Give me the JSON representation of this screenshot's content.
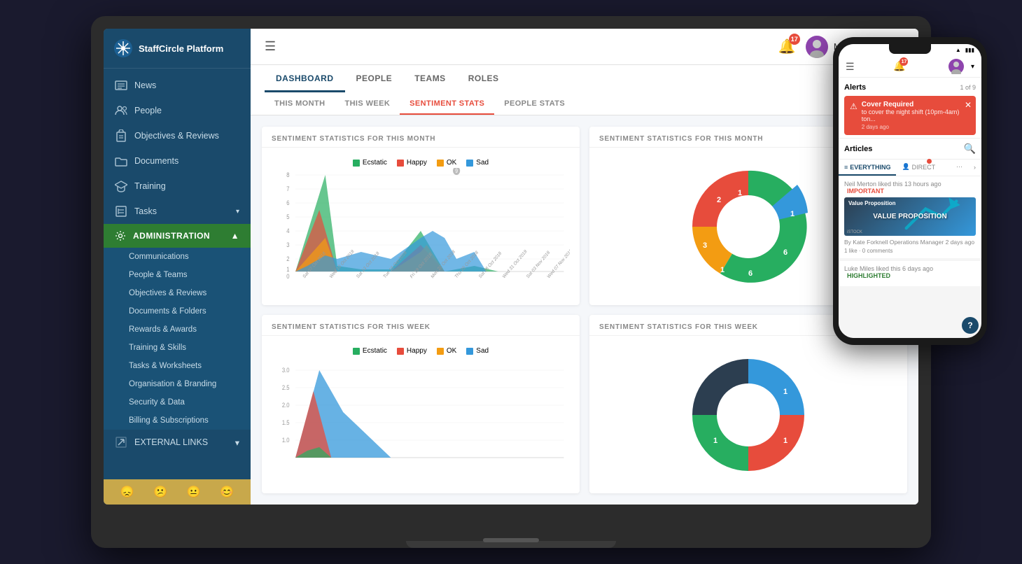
{
  "app": {
    "name": "StaffCircle Platform"
  },
  "topbar": {
    "notification_count": "17",
    "user_name": "Mark Seemann",
    "dropdown": "▾"
  },
  "sidebar": {
    "nav_items": [
      {
        "id": "news",
        "label": "News",
        "icon": "newspaper"
      },
      {
        "id": "people",
        "label": "People",
        "icon": "people"
      },
      {
        "id": "objectives",
        "label": "Objectives & Reviews",
        "icon": "clipboard"
      },
      {
        "id": "documents",
        "label": "Documents",
        "icon": "folder"
      },
      {
        "id": "training",
        "label": "Training",
        "icon": "graduation"
      },
      {
        "id": "tasks",
        "label": "Tasks",
        "icon": "tasks",
        "has_chevron": true
      }
    ],
    "admin_label": "ADMINISTRATION",
    "admin_items": [
      "Communications",
      "People & Teams",
      "Objectives & Reviews",
      "Documents & Folders",
      "Rewards & Awards",
      "Training & Skills",
      "Tasks & Worksheets",
      "Organisation & Branding",
      "Security & Data",
      "Billing & Subscriptions"
    ],
    "external_links_label": "EXTERNAL LINKS"
  },
  "main_tabs": [
    {
      "id": "dashboard",
      "label": "DASHBOARD",
      "active": true
    },
    {
      "id": "people",
      "label": "PEOPLE"
    },
    {
      "id": "teams",
      "label": "TEAMS"
    },
    {
      "id": "roles",
      "label": "ROLES"
    }
  ],
  "sub_tabs": [
    {
      "id": "this_month",
      "label": "THIS MONTH"
    },
    {
      "id": "this_week",
      "label": "THIS WEEK"
    },
    {
      "id": "sentiment_stats",
      "label": "SENTIMENT STATS",
      "active": true
    },
    {
      "id": "people_stats",
      "label": "PEOPLE STATS"
    }
  ],
  "charts": {
    "top_left": {
      "title": "SENTIMENT STATISTICS FOR THIS MONTH",
      "type": "area",
      "legend": [
        "Ecstatic",
        "Happy",
        "OK",
        "Sad"
      ],
      "legend_colors": [
        "#27ae60",
        "#e74c3c",
        "#f39c12",
        "#3498db"
      ]
    },
    "top_right": {
      "title": "SENTIMENT STATISTICS FOR THIS MONTH",
      "type": "donut"
    },
    "bottom_left": {
      "title": "SENTIMENT STATISTICS FOR THIS WEEK",
      "type": "area",
      "legend": [
        "Ecstatic",
        "Happy",
        "OK",
        "Sad"
      ],
      "legend_colors": [
        "#27ae60",
        "#e74c3c",
        "#f39c12",
        "#3498db"
      ]
    },
    "bottom_right": {
      "title": "SENTIMENT STATISTICS FOR THIS WEEK",
      "type": "donut"
    }
  },
  "mobile": {
    "notification_count": "17",
    "alerts_title": "Alerts",
    "alerts_count": "1 of 9",
    "alert": {
      "title": "Cover Required",
      "desc": "to cover the night shift (10pm-4am) ton...",
      "time": "2 days ago"
    },
    "articles_title": "Articles",
    "articles_tabs": [
      "EVERYTHING",
      "DIRECT"
    ],
    "article1": {
      "meta": "Neil Merton liked this 13 hours ago",
      "tag": "IMPORTANT",
      "image_title": "Value Proposition",
      "image_text": "VALUE PROPOSITION"
    },
    "article1_author": "By Kate Forknell Operations Manager 2 days ago",
    "article1_actions": "1 like · 0 comments",
    "article2_meta": "Luke Miles liked this 6 days ago",
    "article2_tag": "HIGHLIGHTED"
  }
}
